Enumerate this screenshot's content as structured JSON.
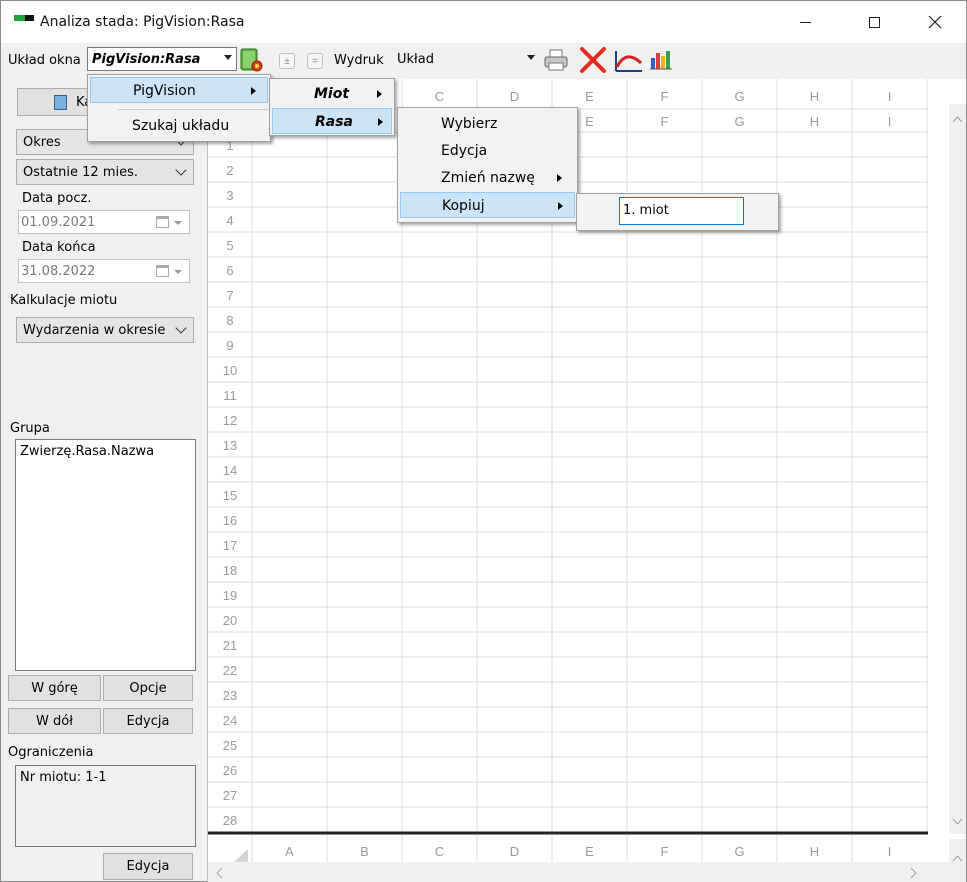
{
  "window": {
    "title": "Analiza stada: PigVision:Rasa",
    "controls": [
      "minimize",
      "maximize",
      "close"
    ]
  },
  "toolbar": {
    "layout_label": "Układ okna",
    "layout_value": "PigVision:Rasa",
    "print_label": "Wydruk",
    "print_layout_value": "Układ",
    "icons": [
      "layout-settings-icon",
      "add-icon",
      "remove-icon",
      "printer-icon",
      "delete-icon",
      "chart-curve-icon",
      "bar-chart-icon"
    ]
  },
  "left_panel": {
    "calc_button_label": "Ka",
    "period_type": "Okres",
    "period_value": "Ostatnie 12 mies.",
    "start_date_label": "Data pocz.",
    "start_date": "01.09.2021",
    "end_date_label": "Data końca",
    "end_date": "31.08.2022",
    "litter_calc_label": "Kalkulacje miotu",
    "litter_calc_value": "Wydarzenia w okresie",
    "group_label": "Grupa",
    "group_items": [
      "Zwierzę.Rasa.Nazwa"
    ],
    "up_button": "W górę",
    "options_button": "Opcje",
    "down_button": "W dół",
    "edit_button": "Edycja",
    "restrictions_label": "Ograniczenia",
    "restrictions_items": [
      "Nr miotu: 1-1"
    ],
    "restrictions_edit_button": "Edycja"
  },
  "grid": {
    "columns": [
      "A",
      "B",
      "C",
      "D",
      "E",
      "F",
      "G",
      "H",
      "I"
    ],
    "rows": [
      "1",
      "2",
      "3",
      "4",
      "5",
      "6",
      "7",
      "8",
      "9",
      "10",
      "11",
      "12",
      "13",
      "14",
      "15",
      "16",
      "17",
      "18",
      "19",
      "20",
      "21",
      "22",
      "23",
      "24",
      "25",
      "26",
      "27",
      "28"
    ]
  },
  "menus": {
    "level1": {
      "items": [
        {
          "label": "PigVision",
          "selected": true,
          "submenu": true
        },
        {
          "label": "Szukaj układu",
          "selected": false,
          "submenu": false
        }
      ]
    },
    "level2": {
      "items": [
        {
          "label": "Miot",
          "selected": false,
          "submenu": true
        },
        {
          "label": "Rasa",
          "selected": true,
          "submenu": true
        }
      ]
    },
    "level3": {
      "items": [
        {
          "label": "Wybierz",
          "submenu": false
        },
        {
          "label": "Edycja",
          "submenu": false
        },
        {
          "label": "Zmień nazwę",
          "submenu": true
        },
        {
          "label": "Kopiuj",
          "selected": true,
          "submenu": true
        }
      ]
    },
    "level4": {
      "edit_value": "1. miot"
    }
  },
  "colors": {
    "menu_highlight": "#cce4f7",
    "menu_highlight_border": "#99c9ef",
    "grid_lines": "#dcdcdc",
    "header_text": "#9a9a9a",
    "accent_blue": "#0078d7"
  }
}
